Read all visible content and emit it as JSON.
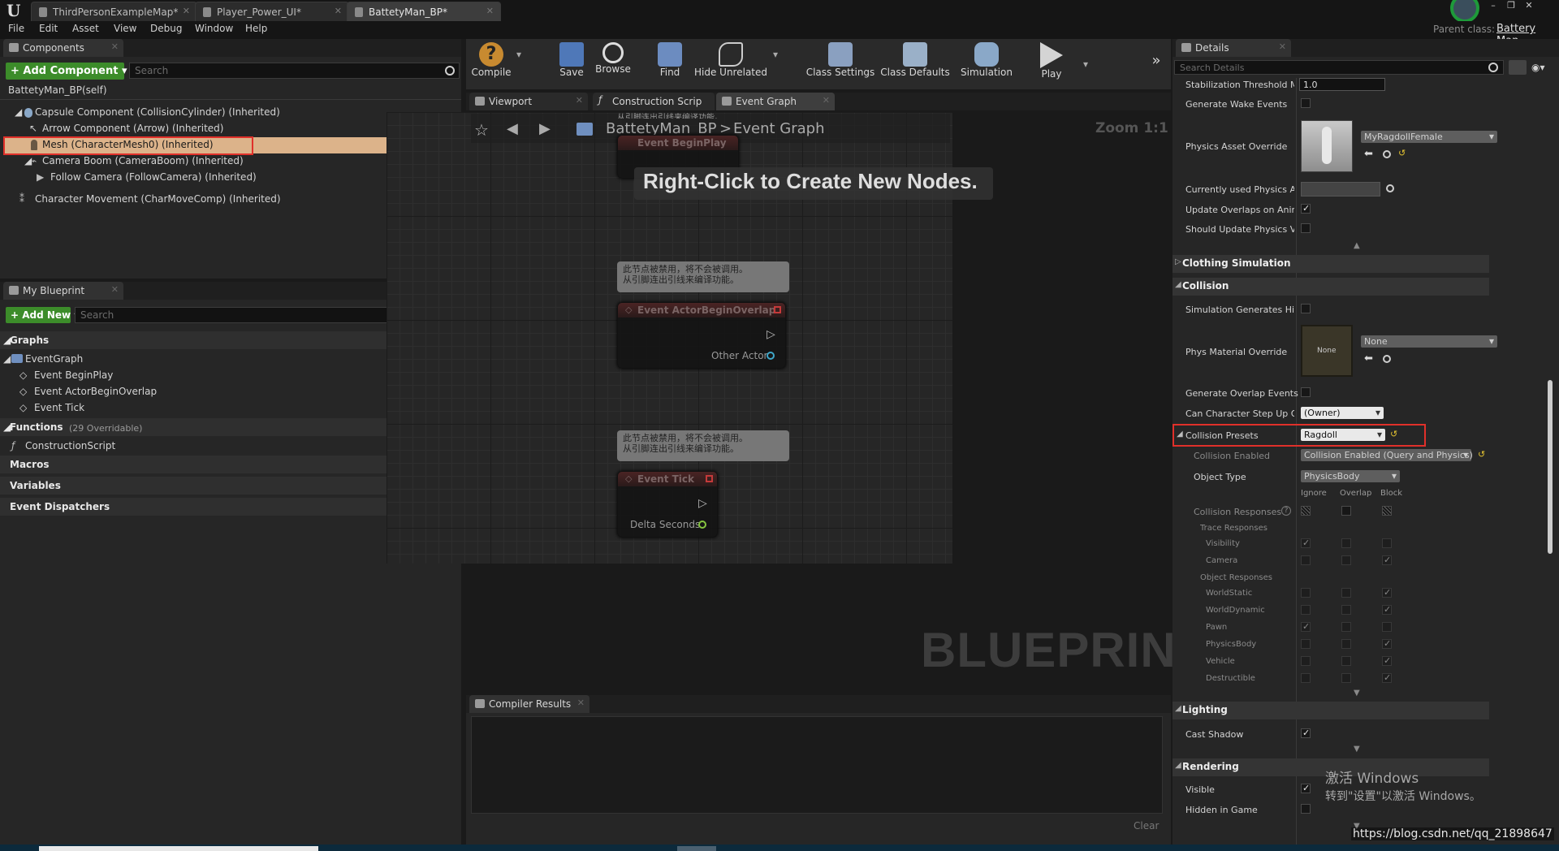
{
  "tabs": [
    {
      "label": "ThirdPersonExampleMap*"
    },
    {
      "label": "Player_Power_UI*"
    },
    {
      "label": "BattetyMan_BP*"
    }
  ],
  "menu": [
    "File",
    "Edit",
    "Asset",
    "View",
    "Debug",
    "Window",
    "Help"
  ],
  "parent_class": {
    "label": "Parent class:",
    "value": "Battery Man"
  },
  "components": {
    "tab": "Components",
    "add_label": "+ Add Component ▾",
    "search_placeholder": "Search",
    "self": "BattetyMan_BP(self)",
    "items": [
      "Capsule Component (CollisionCylinder) (Inherited)",
      "Arrow Component (Arrow) (Inherited)",
      "Mesh (CharacterMesh0) (Inherited)",
      "Camera Boom (CameraBoom) (Inherited)",
      "Follow Camera (FollowCamera) (Inherited)",
      "Character Movement (CharMoveComp) (Inherited)"
    ]
  },
  "my_blueprint": {
    "tab": "My Blueprint",
    "add_new": "+ Add New ▾",
    "search_placeholder": "Search",
    "graphs": "Graphs",
    "event_graph": "EventGraph",
    "events": [
      "Event BeginPlay",
      "Event ActorBeginOverlap",
      "Event Tick"
    ],
    "functions": "Functions",
    "functions_count": "(29 Overridable)",
    "construction": "ConstructionScript",
    "macros": "Macros",
    "variables": "Variables",
    "dispatchers": "Event Dispatchers"
  },
  "toolbar": [
    "Compile",
    "Save",
    "Browse",
    "Find",
    "Hide Unrelated",
    "Class Settings",
    "Class Defaults",
    "Simulation",
    "Play"
  ],
  "editor_tabs": [
    "Viewport",
    "Construction Scrip",
    "Event Graph"
  ],
  "graph": {
    "crumb_root": "BattetyMan_BP",
    "crumb_sep": ">",
    "crumb_leaf": "Event Graph",
    "zoom": "Zoom 1:1",
    "hint": "Right-Click to Create New Nodes.",
    "watermark": "BLUEPRINT",
    "top_node": "Event BeginPlay",
    "top_comment_fragment": "从引脚连出引线来编译功能。",
    "comment_line1": "此节点被禁用，将不会被调用。",
    "comment_line2": "从引脚连出引线来编译功能。",
    "node_overlap": "Event ActorBeginOverlap",
    "pin_other": "Other Actor",
    "node_tick": "Event Tick",
    "pin_delta": "Delta Seconds"
  },
  "compiler": {
    "tab": "Compiler Results",
    "clear": "Clear"
  },
  "details": {
    "tab": "Details",
    "search_placeholder": "Search Details",
    "stab_label": "Stabilization Threshold Mu",
    "stab_value": "1.0",
    "wake": "Generate Wake Events",
    "pao": "Physics Asset Override",
    "pao_value": "MyRagdollFemale",
    "used_pa": "Currently used Physics As",
    "upd_overlaps": "Update Overlaps on Animat",
    "should_upd": "Should Update Physics Volu",
    "clothing": "Clothing Simulation",
    "collision": "Collision",
    "sim_hit": "Simulation Generates Hit E",
    "phys_mat": "Phys Material Override",
    "phys_mat_thumb": "None",
    "phys_mat_value": "None",
    "gen_overlap": "Generate Overlap Events",
    "step_up": "Can Character Step Up On",
    "step_up_value": "(Owner)",
    "presets": "Collision Presets",
    "presets_value": "Ragdoll",
    "enabled": "Collision Enabled",
    "enabled_value": "Collision Enabled (Query and Physics)",
    "object_type": "Object Type",
    "object_type_value": "PhysicsBody",
    "col_ignore": "Ignore",
    "col_overlap": "Overlap",
    "col_block": "Block",
    "responses": "Collision Responses",
    "trace": "Trace Responses",
    "object_resp": "Object Responses",
    "channels": [
      {
        "name": "Visibility",
        "group": "trace",
        "ignore": true,
        "overlap": false,
        "block": false
      },
      {
        "name": "Camera",
        "group": "trace",
        "ignore": false,
        "overlap": false,
        "block": true
      },
      {
        "name": "WorldStatic",
        "group": "object",
        "ignore": false,
        "overlap": false,
        "block": true
      },
      {
        "name": "WorldDynamic",
        "group": "object",
        "ignore": false,
        "overlap": false,
        "block": true
      },
      {
        "name": "Pawn",
        "group": "object",
        "ignore": true,
        "overlap": false,
        "block": false
      },
      {
        "name": "PhysicsBody",
        "group": "object",
        "ignore": false,
        "overlap": false,
        "block": true
      },
      {
        "name": "Vehicle",
        "group": "object",
        "ignore": false,
        "overlap": false,
        "block": true
      },
      {
        "name": "Destructible",
        "group": "object",
        "ignore": false,
        "overlap": false,
        "block": true
      }
    ],
    "lighting": "Lighting",
    "cast_shadow": "Cast Shadow",
    "rendering": "Rendering",
    "visible": "Visible",
    "hidden_game": "Hidden in Game"
  },
  "watermark": {
    "line1": "激活 Windows",
    "line2": "转到\"设置\"以激活 Windows。",
    "url": "https://blog.csdn.net/qq_21898647"
  }
}
